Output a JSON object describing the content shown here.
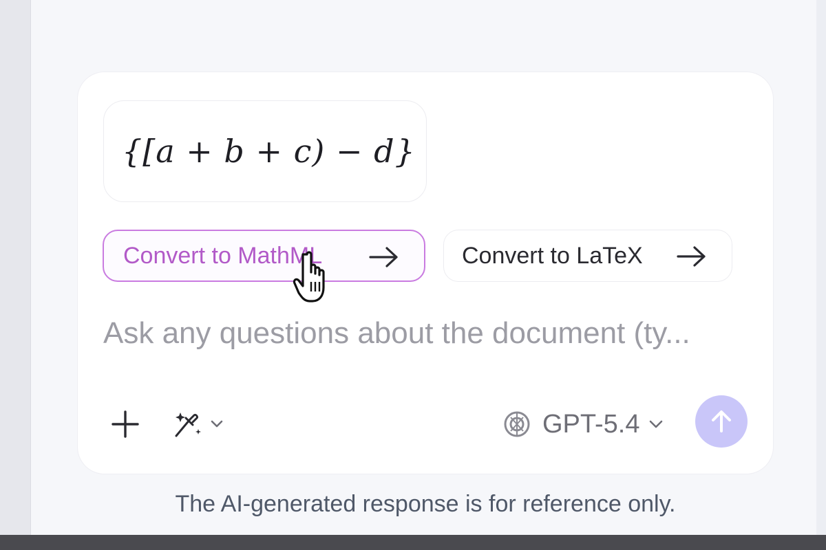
{
  "formula": {
    "text": "{[a + b + c) − d}"
  },
  "actions": {
    "convert_mathml_label": "Convert to MathML",
    "convert_latex_label": "Convert to LaTeX"
  },
  "input": {
    "placeholder": "Ask any questions about the document (ty..."
  },
  "toolbar": {
    "add_icon": "plus-icon",
    "magic_icon": "magic-wand-icon",
    "model_icon": "openai-icon",
    "model_label": "GPT-5.4",
    "send_icon": "arrow-up-icon"
  },
  "footer": {
    "disclaimer": "The AI-generated response is for reference only."
  },
  "colors": {
    "accent": "#c97be0",
    "accent_text": "#b25ac8",
    "send_button": "#c9c6f9"
  }
}
